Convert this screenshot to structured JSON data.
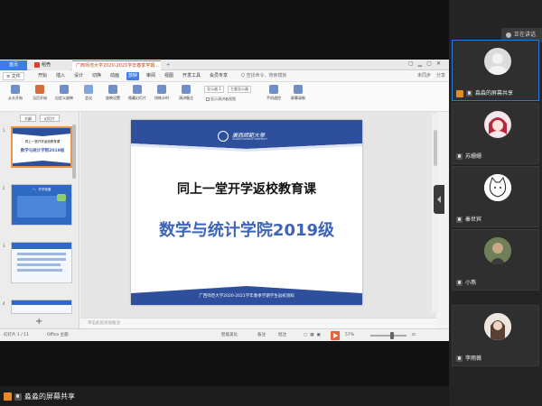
{
  "wps": {
    "tabs": {
      "home": "首页",
      "docs": "稻壳",
      "ppt": "广西师范大学2020-2021学年春季学期…"
    },
    "menu": {
      "file": "≡ 文件",
      "items": [
        "开始",
        "插入",
        "设计",
        "切换",
        "动画",
        "放映",
        "审阅",
        "视图",
        "开发工具",
        "会员专享"
      ],
      "active_index": 5,
      "search": "Q 查找命令、搜索模板",
      "sync": "未同步",
      "share": "分享"
    },
    "ribbon": {
      "buttons": [
        "从头开始",
        "当页开始",
        "自定义放映",
        "会议",
        "放映设置",
        "隐藏幻灯片",
        "排练计时",
        "演讲备注",
        "手机遥控",
        "屏幕录制"
      ],
      "field_monitor": "显示器 1",
      "field_display": "主要显示器",
      "check_label": "显示演讲者视图"
    },
    "leftpanel": {
      "tab_outline": "大纲",
      "tab_slides": "幻灯片",
      "slide_numbers": [
        "1",
        "2",
        "3",
        "4"
      ],
      "thumb1_line1": "同上一堂开学返校教育课",
      "thumb1_line2": "数学与统计学院2019级",
      "thumb2_title": "一、开学准备",
      "add_icon": "+"
    },
    "slide": {
      "university_cn": "廣西師範大學",
      "university_en": "GUANGXI NORMAL UNIVERSITY",
      "title": "同上一堂开学返校教育课",
      "subtitle": "数学与统计学院2019级",
      "footer": "广西师范大学2020-2021学年春季学期学生返校须知"
    },
    "notes_placeholder": "单击此处添加备注",
    "status": {
      "slide_info": "幻灯片 1 / 11",
      "theme": "Office 主题",
      "smart": "智能美化",
      "notes": "备注",
      "comments": "批注",
      "zoom": "57%"
    }
  },
  "participants": {
    "top_button": "正在讲话",
    "tiles": [
      {
        "name": "淼淼的屏幕共享",
        "sharing": true
      },
      {
        "name": "苏姗姗"
      },
      {
        "name": "秦世宾"
      },
      {
        "name": "小燕"
      },
      {
        "name": "李雨薇"
      }
    ]
  },
  "share_label": "淼淼的屏幕共享",
  "colors": {
    "accent_blue": "#3d7de8",
    "slide_blue": "#3d64b5",
    "slide_band": "#2e4f9c",
    "share_orange": "#e48a2a",
    "play_orange": "#e8633a"
  }
}
